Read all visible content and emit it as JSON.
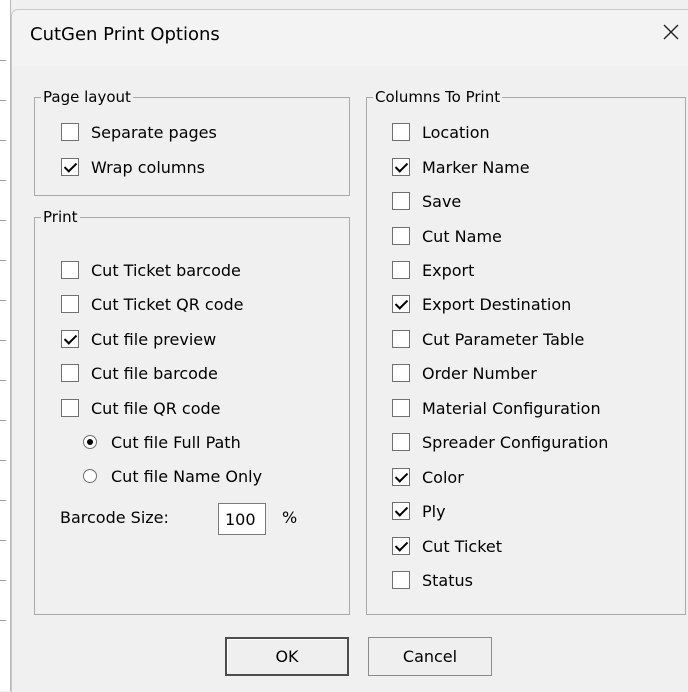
{
  "window": {
    "title": "CutGen Print Options",
    "close_glyph": "✕"
  },
  "page_layout": {
    "label": "Page layout",
    "items": [
      {
        "label": "Separate pages",
        "checked": false
      },
      {
        "label": "Wrap columns",
        "checked": true
      }
    ]
  },
  "print": {
    "label": "Print",
    "items": [
      {
        "label": "Cut Ticket barcode",
        "checked": false
      },
      {
        "label": "Cut Ticket QR code",
        "checked": false
      },
      {
        "label": "Cut file preview",
        "checked": true
      },
      {
        "label": "Cut file barcode",
        "checked": false
      },
      {
        "label": "Cut file QR code",
        "checked": false
      }
    ],
    "radios": [
      {
        "label": "Cut file Full Path",
        "selected": true
      },
      {
        "label": "Cut file Name Only",
        "selected": false
      }
    ],
    "barcode_size": {
      "label": "Barcode Size:",
      "value": "100",
      "unit": "%"
    }
  },
  "columns": {
    "label": "Columns To Print",
    "items": [
      {
        "label": "Location",
        "checked": false
      },
      {
        "label": "Marker Name",
        "checked": true
      },
      {
        "label": "Save",
        "checked": false
      },
      {
        "label": "Cut Name",
        "checked": false
      },
      {
        "label": "Export",
        "checked": false
      },
      {
        "label": "Export Destination",
        "checked": true
      },
      {
        "label": "Cut Parameter Table",
        "checked": false
      },
      {
        "label": "Order Number",
        "checked": false
      },
      {
        "label": "Material Configuration",
        "checked": false
      },
      {
        "label": "Spreader Configuration",
        "checked": false
      },
      {
        "label": "Color",
        "checked": true
      },
      {
        "label": "Ply",
        "checked": true
      },
      {
        "label": "Cut Ticket",
        "checked": true
      },
      {
        "label": "Status",
        "checked": false
      }
    ]
  },
  "buttons": {
    "ok": "OK",
    "cancel": "Cancel"
  }
}
